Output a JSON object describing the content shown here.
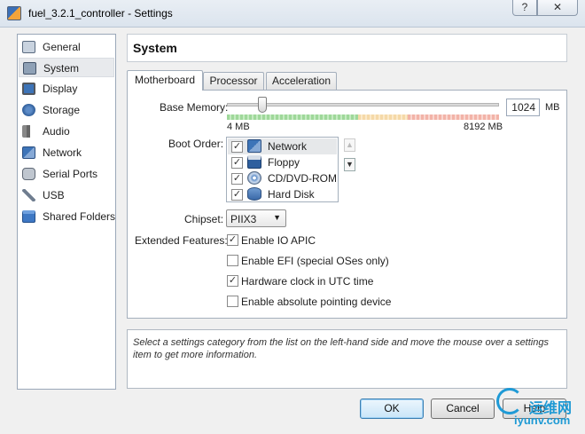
{
  "window": {
    "title": "fuel_3.2.1_controller - Settings",
    "help_label": "?",
    "close_label": "✕"
  },
  "categories": [
    {
      "label": "General",
      "icon": "general-icon"
    },
    {
      "label": "System",
      "icon": "system-icon",
      "selected": true
    },
    {
      "label": "Display",
      "icon": "display-icon"
    },
    {
      "label": "Storage",
      "icon": "storage-icon"
    },
    {
      "label": "Audio",
      "icon": "audio-icon"
    },
    {
      "label": "Network",
      "icon": "network-icon"
    },
    {
      "label": "Serial Ports",
      "icon": "serial-ports-icon"
    },
    {
      "label": "USB",
      "icon": "usb-icon"
    },
    {
      "label": "Shared Folders",
      "icon": "shared-folders-icon"
    }
  ],
  "header": {
    "title": "System"
  },
  "tabs": [
    {
      "label": "Motherboard",
      "active": true
    },
    {
      "label": "Processor"
    },
    {
      "label": "Acceleration"
    }
  ],
  "motherboard": {
    "base_memory": {
      "label": "Base Memory:",
      "value": "1024",
      "unit": "MB",
      "min_label": "4 MB",
      "max_label": "8192 MB",
      "value_fraction": 0.125
    },
    "boot_order": {
      "label": "Boot Order:",
      "items": [
        {
          "label": "Network",
          "checked": true,
          "icon": "network-icon",
          "selected": true
        },
        {
          "label": "Floppy",
          "checked": true,
          "icon": "floppy-icon"
        },
        {
          "label": "CD/DVD-ROM",
          "checked": true,
          "icon": "cd-dvd-icon"
        },
        {
          "label": "Hard Disk",
          "checked": true,
          "icon": "hard-disk-icon"
        }
      ],
      "move_up": "▲",
      "move_down": "▼"
    },
    "chipset": {
      "label": "Chipset:",
      "value": "PIIX3",
      "caret": "▼"
    },
    "extended_features": {
      "label": "Extended Features:",
      "options": [
        {
          "label": "Enable IO APIC",
          "checked": true
        },
        {
          "label": "Enable EFI (special OSes only)",
          "checked": false
        },
        {
          "label": "Hardware clock in UTC time",
          "checked": true
        },
        {
          "label": "Enable absolute pointing device",
          "checked": false
        }
      ]
    }
  },
  "info_text": "Select a settings category from the list on the left-hand side and move the mouse over a settings item to get more information.",
  "buttons": {
    "ok": "OK",
    "cancel": "Cancel",
    "help": "Help"
  },
  "watermark": {
    "cn": "运维网",
    "url": "iyunv.com"
  },
  "colors": {
    "slider_green": "#9fd89a",
    "slider_red": "#f2b3a8",
    "accent": "#3c7fb1"
  }
}
